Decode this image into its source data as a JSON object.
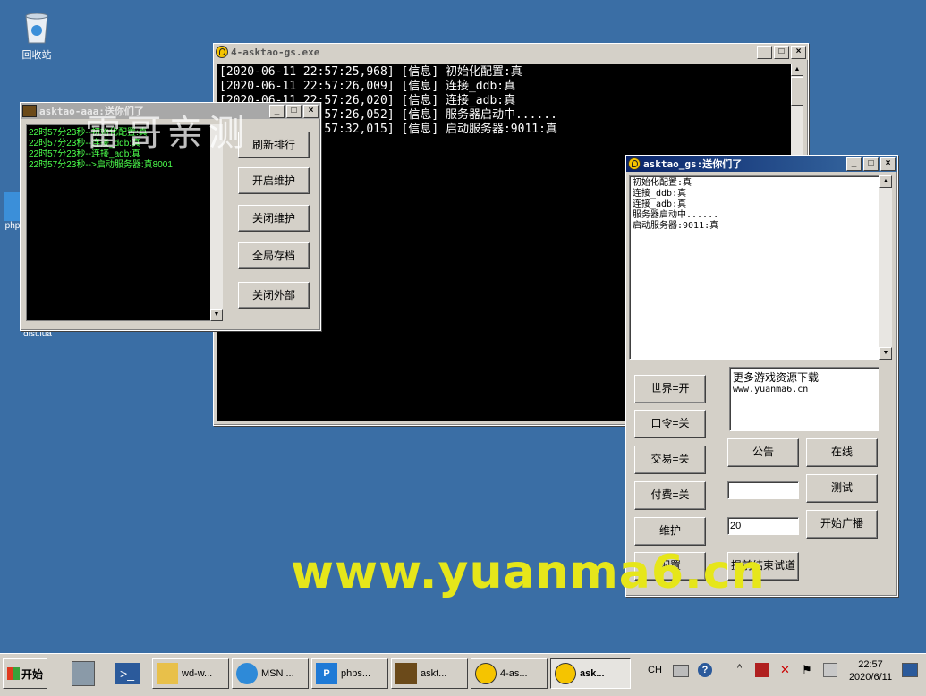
{
  "desktop": {
    "icons": [
      {
        "label": "回收站"
      },
      {
        "label": "php"
      },
      {
        "label": "dist.lua"
      }
    ]
  },
  "colors": {
    "desktop": "#3a6ea5",
    "console_text": "#ffffff",
    "aaa_text": "#4cff4c",
    "watermark": "#e6e61a",
    "title_active": "#0a246a"
  },
  "win_console": {
    "title": "4-asktao-gs.exe",
    "lines": [
      "[2020-06-11 22:57:25,968] [信息] 初始化配置:真",
      "[2020-06-11 22:57:26,009] [信息] 连接_ddb:真",
      "[2020-06-11 22:57:26,020] [信息] 连接_adb:真",
      "[2020-06-11 22:57:26,052] [信息] 服务器启动中......",
      "[2020-06-11 22:57:32,015] [信息] 启动服务器:9011:真"
    ]
  },
  "win_aaa": {
    "title": "asktao-aaa:送你们了",
    "lines": [
      "22时57分23秒--初始化配置:真",
      "22时57分23秒--连接_ddb:真",
      "22时57分23秒--连接_adb:真",
      "22时57分23秒-->启动服务器:真8001"
    ],
    "buttons": [
      "刷新排行",
      "开启维护",
      "关闭维护",
      "全局存档",
      "关闭外部"
    ]
  },
  "win_gs": {
    "title": "asktao_gs:送你们了",
    "log": [
      "初始化配置:真",
      "连接_ddb:真",
      "连接_adb:真",
      "服务器启动中......",
      "启动服务器:9011:真"
    ],
    "left_buttons": [
      "世界=开",
      "口令=关",
      "交易=关",
      "付费=关",
      "维护",
      "配置"
    ],
    "notice_box": [
      "更多游戏资源下载",
      "www.yuanma6.cn"
    ],
    "btn_announce": "公告",
    "btn_online": "在线",
    "btn_test": "测试",
    "btn_broadcast": "开始广播",
    "btn_end_trial": "提前结束试道",
    "input1": "",
    "input2": "20"
  },
  "watermark": {
    "overlay": "雷哥亲测",
    "url": "www.yuanma6.cn"
  },
  "taskbar": {
    "start": "开始",
    "tasks": [
      "wd-w...",
      "MSN ...",
      "phps...",
      "askt...",
      "4-as...",
      "ask..."
    ],
    "lang": "CH",
    "time": "22:57",
    "date": "2020/6/11"
  }
}
